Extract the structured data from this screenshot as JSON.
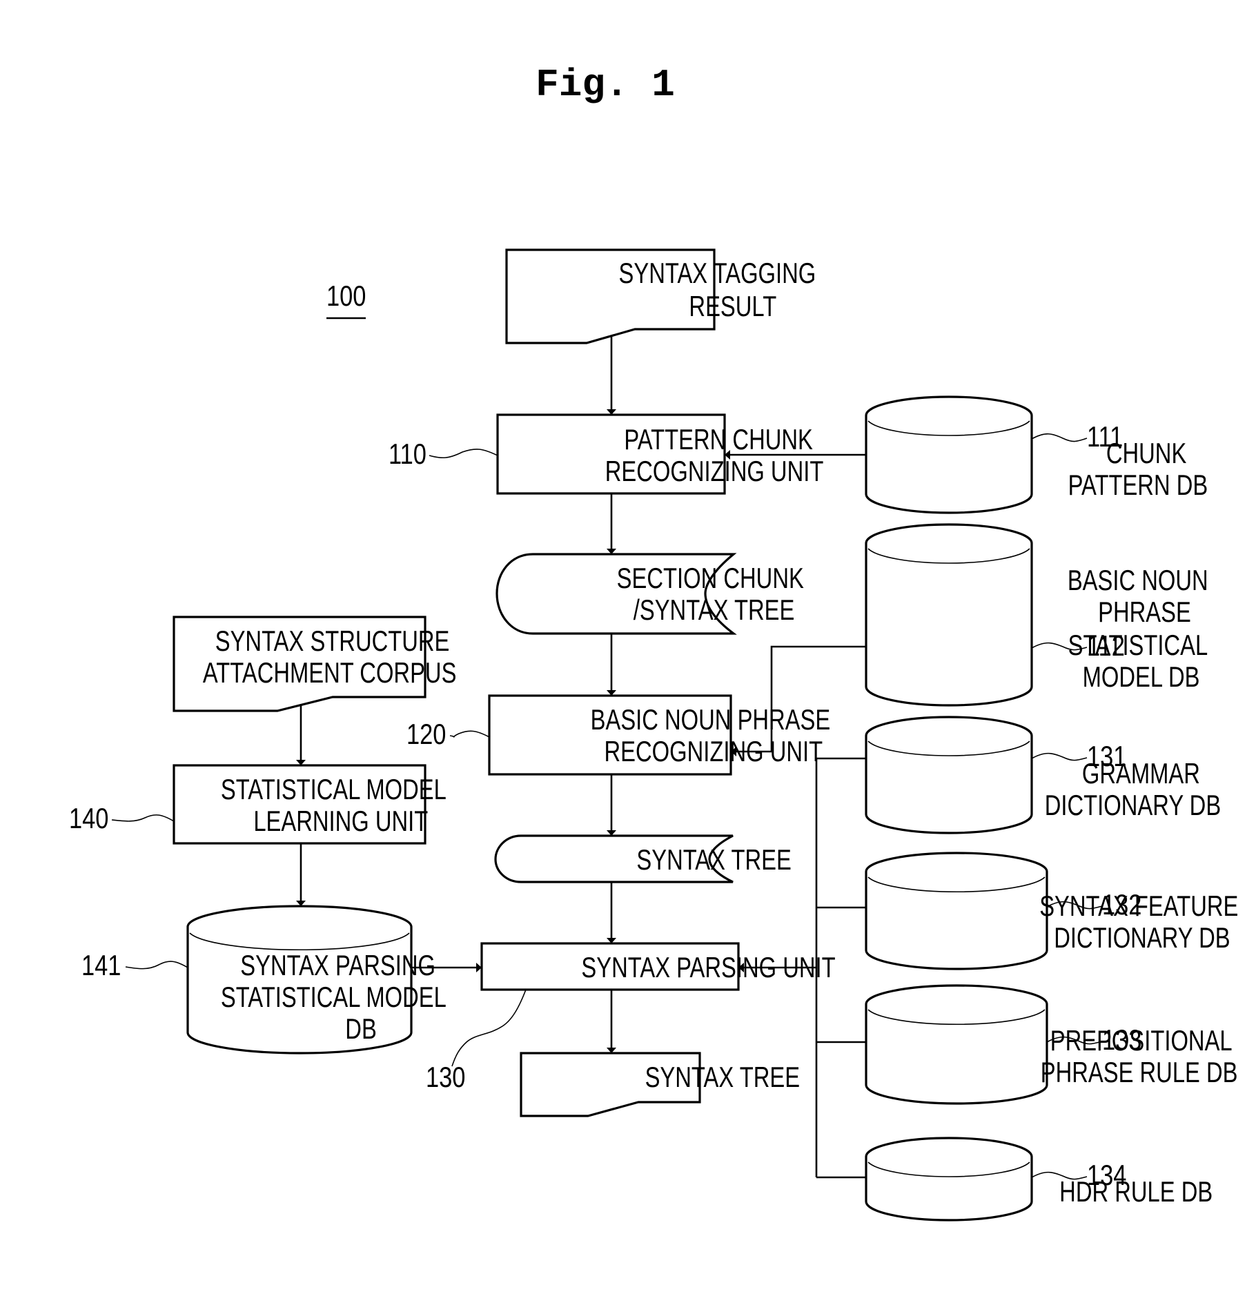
{
  "figure": {
    "title": "Fig. 1",
    "system_ref": "100"
  },
  "nodes": {
    "tagging_result": {
      "ref": "",
      "lines": [
        "SYNTAX TAGGING",
        "RESULT"
      ],
      "shape": "document"
    },
    "pattern_chunk_unit": {
      "ref": "110",
      "lines": [
        "PATTERN CHUNK",
        "RECOGNIZING UNIT"
      ],
      "shape": "process"
    },
    "chunk_pattern_db": {
      "ref": "111",
      "lines": [
        "CHUNK",
        "PATTERN DB"
      ],
      "shape": "database"
    },
    "section_chunk_tree": {
      "ref": "",
      "lines": [
        "SECTION CHUNK",
        "/SYNTAX TREE"
      ],
      "shape": "stored-data"
    },
    "bnp_model_db": {
      "ref": "112",
      "lines": [
        "BASIC NOUN",
        "PHRASE",
        "STATISTICAL",
        "MODEL DB"
      ],
      "shape": "database"
    },
    "corpus": {
      "ref": "",
      "lines": [
        "SYNTAX STRUCTURE",
        "ATTACHMENT CORPUS"
      ],
      "shape": "document"
    },
    "bnp_unit": {
      "ref": "120",
      "lines": [
        "BASIC NOUN PHRASE",
        "RECOGNIZING UNIT"
      ],
      "shape": "process"
    },
    "grammar_db": {
      "ref": "131",
      "lines": [
        "GRAMMAR",
        "DICTIONARY DB"
      ],
      "shape": "database"
    },
    "learning_unit": {
      "ref": "140",
      "lines": [
        "STATISTICAL MODEL",
        "LEARNING UNIT"
      ],
      "shape": "process"
    },
    "syntax_tree_mid": {
      "ref": "",
      "lines": [
        "SYNTAX TREE"
      ],
      "shape": "stored-data"
    },
    "syntax_feature_db": {
      "ref": "132",
      "lines": [
        "SYNTAX FEATURE",
        "DICTIONARY DB"
      ],
      "shape": "database"
    },
    "parse_model_db": {
      "ref": "141",
      "lines": [
        "SYNTAX PARSING",
        "STATISTICAL MODEL",
        "DB"
      ],
      "shape": "database"
    },
    "parsing_unit": {
      "ref": "130",
      "lines": [
        "SYNTAX PARSING UNIT"
      ],
      "shape": "process"
    },
    "prep_rule_db": {
      "ref": "133",
      "lines": [
        "PREPOSITIONAL",
        "PHRASE RULE DB"
      ],
      "shape": "database"
    },
    "syntax_tree_out": {
      "ref": "",
      "lines": [
        "SYNTAX TREE"
      ],
      "shape": "document"
    },
    "hdr_rule_db": {
      "ref": "134",
      "lines": [
        "HDR RULE DB"
      ],
      "shape": "database"
    }
  },
  "edges": [
    {
      "from": "tagging_result",
      "to": "pattern_chunk_unit"
    },
    {
      "from": "chunk_pattern_db",
      "to": "pattern_chunk_unit"
    },
    {
      "from": "pattern_chunk_unit",
      "to": "section_chunk_tree"
    },
    {
      "from": "section_chunk_tree",
      "to": "bnp_unit"
    },
    {
      "from": "bnp_model_db",
      "to": "bnp_unit"
    },
    {
      "from": "bnp_unit",
      "to": "syntax_tree_mid"
    },
    {
      "from": "syntax_tree_mid",
      "to": "parsing_unit"
    },
    {
      "from": "corpus",
      "to": "learning_unit"
    },
    {
      "from": "learning_unit",
      "to": "parse_model_db"
    },
    {
      "from": "parse_model_db",
      "to": "parsing_unit"
    },
    {
      "from": "grammar_db",
      "to": "parsing_unit"
    },
    {
      "from": "syntax_feature_db",
      "to": "parsing_unit"
    },
    {
      "from": "prep_rule_db",
      "to": "parsing_unit"
    },
    {
      "from": "hdr_rule_db",
      "to": "parsing_unit"
    },
    {
      "from": "parsing_unit",
      "to": "syntax_tree_out"
    }
  ]
}
